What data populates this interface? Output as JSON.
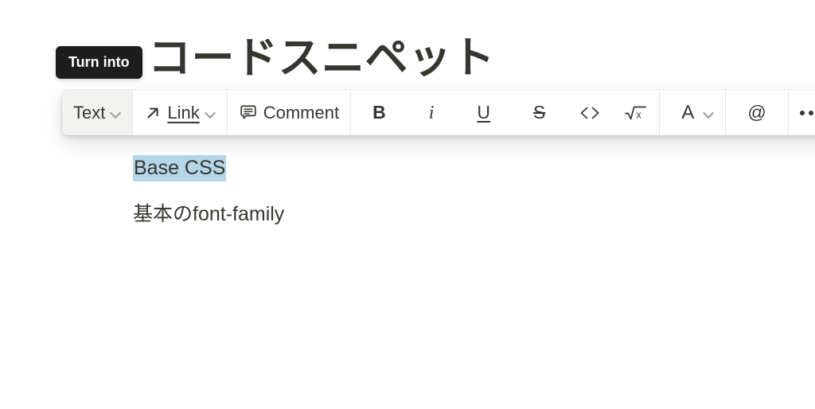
{
  "document": {
    "heading": "コードスニペット",
    "selected_text": "Base CSS",
    "selection_color": "#b4d6e8",
    "body_line": "基本のfont-family",
    "text_color": "#37352f"
  },
  "tooltip": {
    "label": "Turn into",
    "background": "#1d1d1d",
    "text_color": "#ffffff"
  },
  "toolbar": {
    "block_type": {
      "label": "Text",
      "icon": "chevron-down-icon",
      "state": "hovered"
    },
    "link": {
      "label": "Link",
      "icon": "arrow-up-right-icon",
      "chevron": "chevron-down-icon"
    },
    "comment": {
      "label": "Comment",
      "icon": "comment-bubble-icon"
    },
    "format_buttons": [
      {
        "name": "bold",
        "glyph": "B"
      },
      {
        "name": "italic",
        "glyph": "i"
      },
      {
        "name": "underline",
        "glyph": "U"
      },
      {
        "name": "strikethrough",
        "glyph": "S"
      },
      {
        "name": "inline-code",
        "glyph": "<>"
      },
      {
        "name": "equation",
        "glyph": "√x"
      }
    ],
    "text_color_button": {
      "glyph": "A",
      "chevron": "chevron-down-icon"
    },
    "mention_button": {
      "glyph": "@"
    },
    "more_button": {
      "icon": "ellipsis-icon"
    }
  }
}
